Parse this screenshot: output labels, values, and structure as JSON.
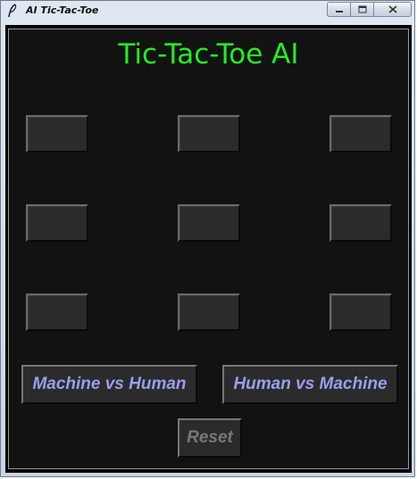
{
  "window": {
    "title": "AI Tic-Tac-Toe",
    "icon": "feather-icon",
    "controls": [
      "minimize-icon",
      "maximize-icon",
      "close-icon"
    ]
  },
  "app": {
    "heading": "Tic-Tac-Toe AI",
    "heading_color": "#22ee22",
    "background_color": "#121212"
  },
  "board": {
    "cells": [
      "",
      "",
      "",
      "",
      "",
      "",
      "",
      "",
      ""
    ]
  },
  "controls": {
    "machine_vs_human_label": "Machine vs Human",
    "human_vs_machine_label": "Human vs Machine",
    "reset_label": "Reset",
    "mode_text_color": "#9a9ef0",
    "reset_text_color": "#777777"
  }
}
